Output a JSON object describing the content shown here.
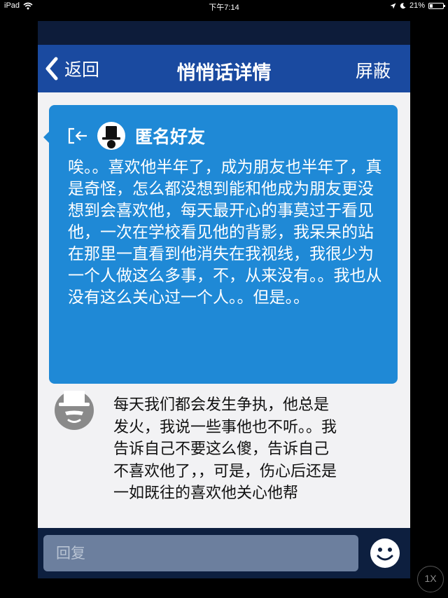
{
  "status_bar": {
    "device": "iPad",
    "time": "下午7:14",
    "battery": "21%",
    "battery_level": 0.21
  },
  "nav": {
    "back_label": "返回",
    "title": "悄悄话详情",
    "right_label": "屏蔽"
  },
  "message": {
    "sender": "匿名好友",
    "text": "唉。。喜欢他半年了，成为朋友也半年了，真是奇怪，怎么都没想到能和他成为朋友更没想到会喜欢他，每天最开心的事莫过于看见他，一次在学校看见他的背影，我呆呆的站在那里一直看到他消失在我视线，我很少为一个人做这么多事，不，从来没有。。我也从没有这么关心过一个人。。但是。。"
  },
  "reply": {
    "text": "每天我们都会发生争执，他总是发火，我说一些事他也不听。。我告诉自己不要这么傻，告诉自己不喜欢他了，，可是，伤心后还是一如既往的喜欢他关心他帮"
  },
  "input": {
    "placeholder": "回复"
  },
  "overlay": {
    "speed": "1X"
  },
  "colors": {
    "nav_bg": "#1a4aa0",
    "bubble_bg": "#1f89d6",
    "content_bg": "#f2f2f4",
    "input_bar_bg": "#0d1f3f",
    "emoji_yellow": "#ffffff"
  },
  "icons": {
    "back": "chevron-left-icon",
    "exit": "exit-icon",
    "anonymous_avatar": "anonymous-hat-avatar",
    "emoji": "smiley-icon",
    "wifi": "wifi-icon",
    "moon": "moon-icon"
  }
}
